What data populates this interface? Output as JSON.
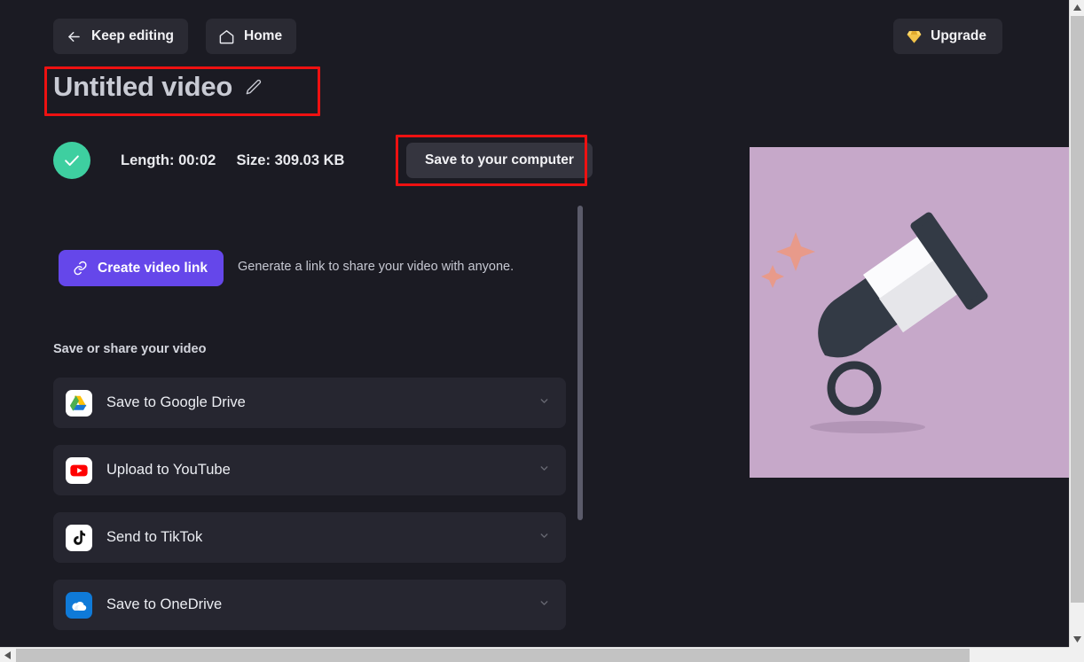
{
  "topbar": {
    "keep_editing_label": "Keep editing",
    "home_label": "Home",
    "upgrade_label": "Upgrade"
  },
  "title": {
    "text": "Untitled video",
    "edit_icon": "pencil-icon"
  },
  "status": {
    "icon": "check-circle-icon",
    "length_label": "Length: 00:02",
    "size_label": "Size: 309.03 KB",
    "save_to_computer_label": "Save to your computer"
  },
  "share": {
    "create_link_label": "Create video link",
    "create_link_icon": "link-icon",
    "create_link_hint": "Generate a link to share your video with anyone.",
    "section_title": "Save or share your video",
    "items": [
      {
        "label": "Save to Google Drive",
        "icon": "google-drive-icon",
        "chevron": "chevron-down-icon"
      },
      {
        "label": "Upload to YouTube",
        "icon": "youtube-icon",
        "chevron": "chevron-down-icon"
      },
      {
        "label": "Send to TikTok",
        "icon": "tiktok-icon",
        "chevron": "chevron-down-icon"
      },
      {
        "label": "Save to OneDrive",
        "icon": "onedrive-icon",
        "chevron": "chevron-down-icon"
      }
    ]
  },
  "illustration": {
    "name": "megaphone-illustration",
    "background_color": "#c6a8c9"
  },
  "colors": {
    "page_background": "#1b1b23",
    "surface": "#2a2a33",
    "row_surface": "#262630",
    "accent_purple": "#6547ea",
    "success_green": "#3ecfa0",
    "upgrade_gold": "#f2c349",
    "annotation_red": "#ee1111"
  },
  "annotations": [
    {
      "name": "title-highlight",
      "target": "Untitled video"
    },
    {
      "name": "save-button-highlight",
      "target": "Save to your computer"
    }
  ]
}
